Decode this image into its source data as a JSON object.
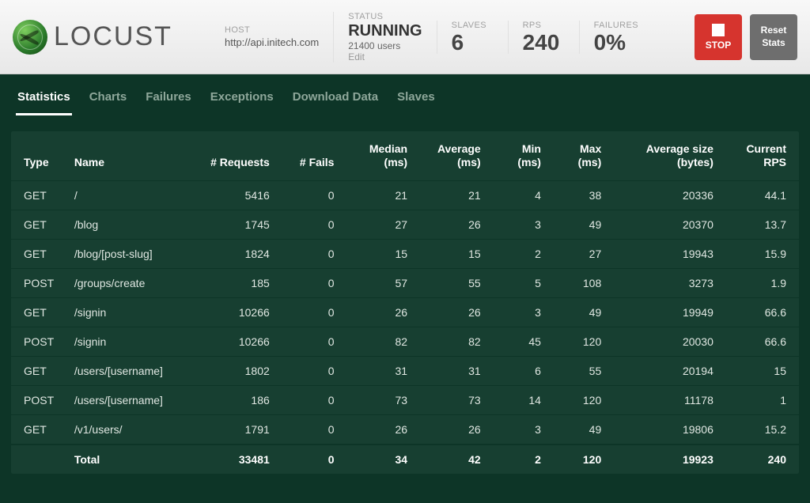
{
  "brand": "LOCUST",
  "header": {
    "host_label": "HOST",
    "host_value": "http://api.initech.com",
    "status_label": "STATUS",
    "status_value": "RUNNING",
    "users_sub": "21400 users",
    "edit_label": "Edit",
    "slaves_label": "SLAVES",
    "slaves_value": "6",
    "rps_label": "RPS",
    "rps_value": "240",
    "failures_label": "FAILURES",
    "failures_value": "0%",
    "stop_label": "STOP",
    "reset_label": "Reset\nStats"
  },
  "tabs": [
    "Statistics",
    "Charts",
    "Failures",
    "Exceptions",
    "Download Data",
    "Slaves"
  ],
  "columns": {
    "type": "Type",
    "name": "Name",
    "requests": "# Requests",
    "fails": "# Fails",
    "median": "Median (ms)",
    "average": "Average (ms)",
    "min": "Min (ms)",
    "max": "Max (ms)",
    "avg_size": "Average size (bytes)",
    "current_rps": "Current RPS"
  },
  "rows": [
    {
      "type": "GET",
      "name": "/",
      "requests": "5416",
      "fails": "0",
      "median": "21",
      "average": "21",
      "min": "4",
      "max": "38",
      "size": "20336",
      "rps": "44.1"
    },
    {
      "type": "GET",
      "name": "/blog",
      "requests": "1745",
      "fails": "0",
      "median": "27",
      "average": "26",
      "min": "3",
      "max": "49",
      "size": "20370",
      "rps": "13.7"
    },
    {
      "type": "GET",
      "name": "/blog/[post-slug]",
      "requests": "1824",
      "fails": "0",
      "median": "15",
      "average": "15",
      "min": "2",
      "max": "27",
      "size": "19943",
      "rps": "15.9"
    },
    {
      "type": "POST",
      "name": "/groups/create",
      "requests": "185",
      "fails": "0",
      "median": "57",
      "average": "55",
      "min": "5",
      "max": "108",
      "size": "3273",
      "rps": "1.9"
    },
    {
      "type": "GET",
      "name": "/signin",
      "requests": "10266",
      "fails": "0",
      "median": "26",
      "average": "26",
      "min": "3",
      "max": "49",
      "size": "19949",
      "rps": "66.6"
    },
    {
      "type": "POST",
      "name": "/signin",
      "requests": "10266",
      "fails": "0",
      "median": "82",
      "average": "82",
      "min": "45",
      "max": "120",
      "size": "20030",
      "rps": "66.6"
    },
    {
      "type": "GET",
      "name": "/users/[username]",
      "requests": "1802",
      "fails": "0",
      "median": "31",
      "average": "31",
      "min": "6",
      "max": "55",
      "size": "20194",
      "rps": "15"
    },
    {
      "type": "POST",
      "name": "/users/[username]",
      "requests": "186",
      "fails": "0",
      "median": "73",
      "average": "73",
      "min": "14",
      "max": "120",
      "size": "11178",
      "rps": "1"
    },
    {
      "type": "GET",
      "name": "/v1/users/",
      "requests": "1791",
      "fails": "0",
      "median": "26",
      "average": "26",
      "min": "3",
      "max": "49",
      "size": "19806",
      "rps": "15.2"
    }
  ],
  "total": {
    "type": "",
    "name": "Total",
    "requests": "33481",
    "fails": "0",
    "median": "34",
    "average": "42",
    "min": "2",
    "max": "120",
    "size": "19923",
    "rps": "240"
  }
}
